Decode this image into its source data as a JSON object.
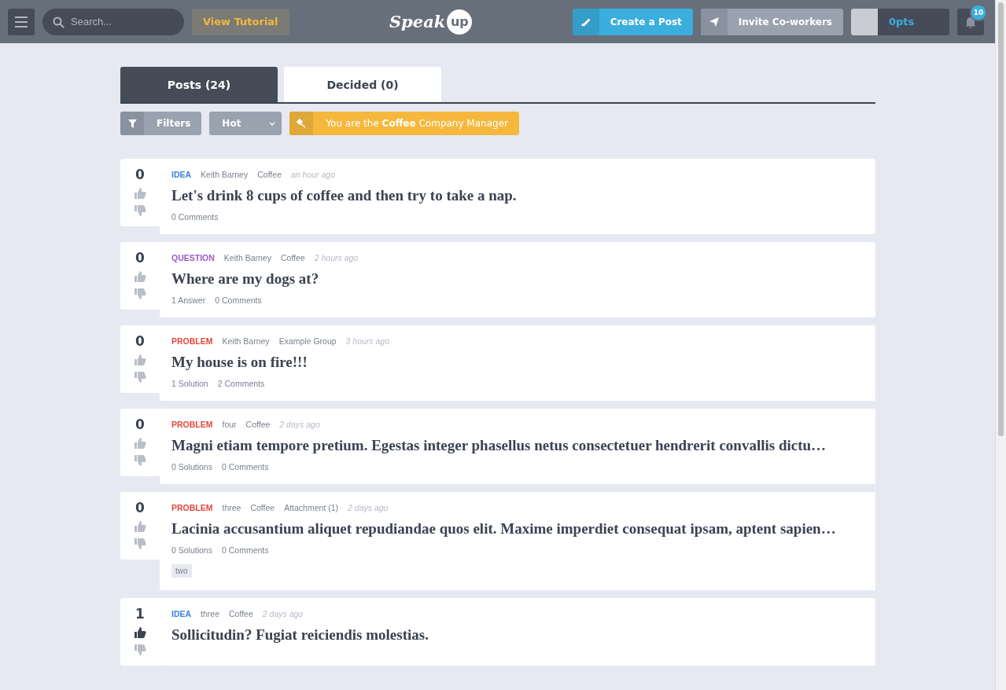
{
  "header": {
    "search": {
      "placeholder": "Search..."
    },
    "tutorial_button": "View Tutorial",
    "logo": {
      "word": "Speak",
      "badge": "up"
    },
    "create_button": "Create a Post",
    "invite_button": "Invite Co-workers",
    "points": "0pts",
    "notifications": "10"
  },
  "tabs": [
    {
      "label": "Posts (24)",
      "selected": true
    },
    {
      "label": "Decided (0)",
      "selected": false
    }
  ],
  "toolbar": {
    "filters": "Filters",
    "sort": "Hot",
    "role_banner": "You are the **Coffee** Company Manager"
  },
  "posts": [
    {
      "score": "0",
      "upvoted": false,
      "kind": "idea",
      "type": "IDEA",
      "meta": [
        "Keith Barney",
        "Coffee"
      ],
      "time": "an hour ago",
      "title": "Let's drink 8 cups of coffee and then try to take a nap.",
      "stats": [
        "0 Comments"
      ]
    },
    {
      "score": "0",
      "upvoted": false,
      "kind": "question",
      "type": "QUESTION",
      "meta": [
        "Keith Barney",
        "Coffee"
      ],
      "time": "2 hours ago",
      "title": "Where are my dogs at?",
      "stats": [
        "1 Answer",
        "0 Comments"
      ]
    },
    {
      "score": "0",
      "upvoted": false,
      "kind": "problem",
      "type": "PROBLEM",
      "meta": [
        "Keith Barney",
        "Example Group"
      ],
      "time": "3 hours ago",
      "title": "My house is on fire!!!",
      "stats": [
        "1 Solution",
        "2 Comments"
      ]
    },
    {
      "score": "0",
      "upvoted": false,
      "kind": "problem",
      "type": "PROBLEM",
      "meta": [
        "four",
        "Coffee"
      ],
      "time": "2 days ago",
      "title": "Magni etiam tempore pretium. Egestas integer phasellus netus consectetuer hendrerit convallis dictu…",
      "stats": [
        "0 Solutions",
        "0 Comments"
      ]
    },
    {
      "score": "0",
      "upvoted": false,
      "kind": "problem",
      "type": "PROBLEM",
      "meta": [
        "three",
        "Coffee",
        "Attachment (1)"
      ],
      "time": "2 days ago",
      "title": "Lacinia accusantium aliquet repudiandae quos elit. Maxime imperdiet consequat ipsam, aptent sapien…",
      "stats": [
        "0 Solutions",
        "0 Comments"
      ],
      "tags": [
        "two"
      ]
    },
    {
      "score": "1",
      "upvoted": true,
      "kind": "idea",
      "type": "IDEA",
      "meta": [
        "three",
        "Coffee"
      ],
      "time": "2 days ago",
      "title": "Sollicitudin? Fugiat reiciendis molestias."
    }
  ]
}
